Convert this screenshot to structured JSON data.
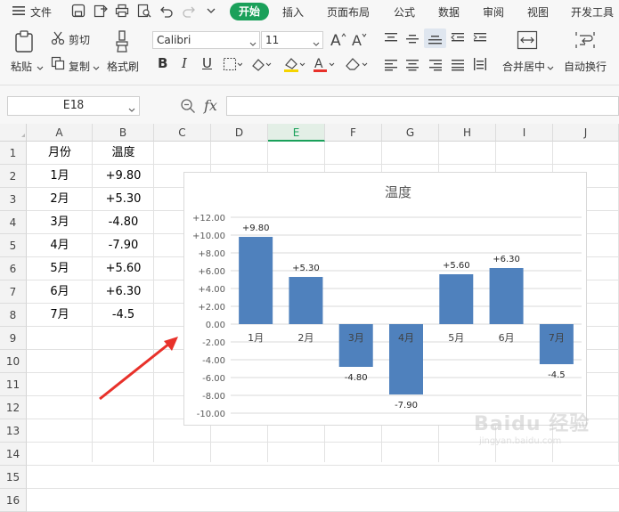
{
  "menubar": {
    "file_label": "文件",
    "tabs": [
      "开始",
      "插入",
      "页面布局",
      "公式",
      "数据",
      "审阅",
      "视图",
      "开发工具"
    ]
  },
  "ribbon": {
    "paste_label": "粘贴",
    "cut_label": "剪切",
    "copy_label": "复制",
    "format_painter_label": "格式刷",
    "font_name": "Calibri",
    "font_size": "11",
    "merge_label": "合并居中",
    "wrap_label": "自动换行"
  },
  "formula_bar": {
    "cell_ref": "E18",
    "fx_label": "fx",
    "value": ""
  },
  "sheet": {
    "columns": [
      "A",
      "B",
      "C",
      "D",
      "E",
      "F",
      "G",
      "H",
      "I",
      "J"
    ],
    "selected_column": "E",
    "rows": [
      "1",
      "2",
      "3",
      "4",
      "5",
      "6",
      "7",
      "8",
      "9",
      "10",
      "11",
      "12",
      "13",
      "14",
      "15",
      "16"
    ],
    "cells": [
      {
        "a": "月份",
        "b": "温度"
      },
      {
        "a": "1月",
        "b": "+9.80"
      },
      {
        "a": "2月",
        "b": "+5.30"
      },
      {
        "a": "3月",
        "b": "-4.80"
      },
      {
        "a": "4月",
        "b": "-7.90"
      },
      {
        "a": "5月",
        "b": "+5.60"
      },
      {
        "a": "6月",
        "b": "+6.30"
      },
      {
        "a": "7月",
        "b": "-4.5"
      }
    ]
  },
  "chart_data": {
    "type": "bar",
    "title": "温度",
    "categories": [
      "1月",
      "2月",
      "3月",
      "4月",
      "5月",
      "6月",
      "7月"
    ],
    "values": [
      9.8,
      5.3,
      -4.8,
      -7.9,
      5.6,
      6.3,
      -4.5
    ],
    "data_labels": [
      "+9.80",
      "+5.30",
      "-4.80",
      "-7.90",
      "+5.60",
      "+6.30",
      "-4.5"
    ],
    "ylim": [
      -10,
      12
    ],
    "yticks": [
      "+12.00",
      "+10.00",
      "+8.00",
      "+6.00",
      "+4.00",
      "+2.00",
      "0.00",
      "-2.00",
      "-4.00",
      "-6.00",
      "-8.00",
      "-10.00"
    ],
    "ytick_values": [
      12,
      10,
      8,
      6,
      4,
      2,
      0,
      -2,
      -4,
      -6,
      -8,
      -10
    ],
    "grid": true,
    "bar_color": "#4f81bd"
  },
  "colors": {
    "accent": "#1aa05a",
    "arrow": "#e8312a"
  },
  "watermark": {
    "text": "Baidu 经验",
    "subtext": "jingyan.baidu.com"
  }
}
